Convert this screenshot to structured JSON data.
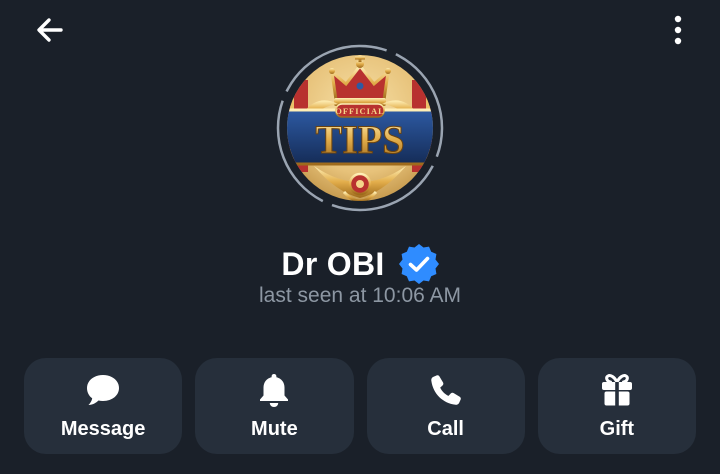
{
  "header": {
    "back_icon": "arrow-left-icon",
    "menu_icon": "more-vertical-icon"
  },
  "profile": {
    "avatar": {
      "badge_top_text": "OFFICIAL",
      "badge_main_text": "TIPS",
      "colors": {
        "ring": "#9aa4b1",
        "gold": "#d8a64a",
        "navy": "#1f3f7a",
        "red": "#b8312f"
      }
    },
    "name": "Dr OBI",
    "verified_icon": "verified-badge-icon",
    "verified_color": "#2f8cff",
    "status": "last seen at 10:06 AM"
  },
  "actions": [
    {
      "label": "Message",
      "icon": "chat-bubble-icon"
    },
    {
      "label": "Mute",
      "icon": "bell-icon"
    },
    {
      "label": "Call",
      "icon": "phone-icon"
    },
    {
      "label": "Gift",
      "icon": "gift-icon"
    }
  ],
  "theme": {
    "background": "#1a2029",
    "button_bg": "#262f3b",
    "secondary_text": "#8d97a3"
  }
}
